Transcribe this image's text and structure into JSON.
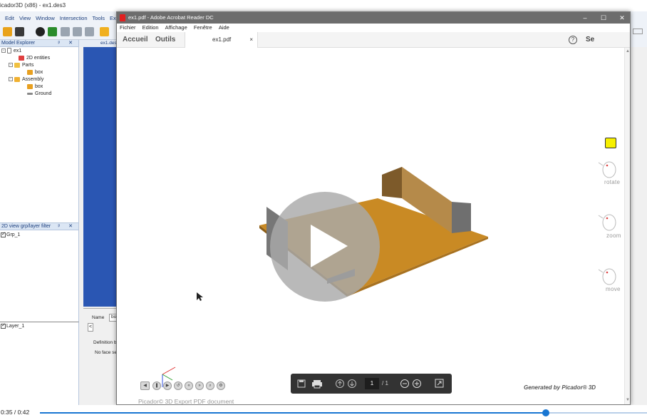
{
  "bg_app": {
    "title": "icador3D (x86) - ex1.des3",
    "menu": [
      "Edit",
      "View",
      "Window",
      "Intersection",
      "Tools",
      "Expo"
    ],
    "viewport_tab": "ex1.des",
    "model_explorer": {
      "title": "Model Explorer",
      "items": [
        "ex1",
        "2D entities",
        "Parts",
        "box",
        "Assembly",
        "box",
        "Ground"
      ]
    },
    "layer_filter": {
      "title": "2D view grp/layer filter",
      "items": [
        "Grp_1"
      ]
    },
    "layers": {
      "items": [
        "Layer_1"
      ]
    },
    "props": {
      "name_label": "Name",
      "name_value": "bo",
      "definition": "Definition b",
      "face_msg": "No face se"
    }
  },
  "acrobat": {
    "title": "ex1.pdf - Adobe Acrobat Reader DC",
    "window_buttons": {
      "minimize": "–",
      "maximize": "☐",
      "close": "✕"
    },
    "menu": [
      "Fichier",
      "Edition",
      "Affichage",
      "Fenêtre",
      "Aide"
    ],
    "tabs": {
      "home": "Accueil",
      "tools": "Outils"
    },
    "doc_tab": {
      "label": "ex1.pdf",
      "close": "×"
    },
    "help": "?",
    "connect": "Se connecter"
  },
  "page": {
    "tools": [
      "rotate",
      "zoom",
      "move"
    ],
    "generated": "Generated by Picador® 3D",
    "export_caption": "Picador© 3D Export PDF document",
    "page_number": "1",
    "page_total": "/ 1"
  },
  "video": {
    "time": "0:35 / 0:42",
    "progress": 0.833,
    "colors": {
      "fill": "#1976d2",
      "track": "#b9cfe9"
    }
  },
  "icons": [
    "play-icon",
    "save-icon",
    "print-icon",
    "page-up-icon",
    "page-down-icon",
    "zoom-out-icon",
    "zoom-in-icon",
    "fullscreen-icon",
    "comment-icon",
    "mouse-icon",
    "help-icon"
  ]
}
